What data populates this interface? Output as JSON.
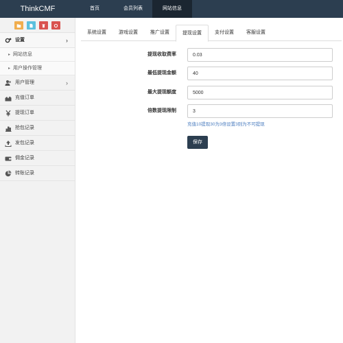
{
  "brand": "ThinkCMF",
  "topnav": {
    "items": [
      {
        "label": "首页"
      },
      {
        "label": "会员列表"
      },
      {
        "label": "网站信息"
      }
    ]
  },
  "sidebar": {
    "shortcuts": [
      {
        "icon": "folder-icon",
        "color": "#f0ad4e"
      },
      {
        "icon": "file-icon",
        "color": "#5bc0de"
      },
      {
        "icon": "trash-icon",
        "color": "#d9534f"
      },
      {
        "icon": "recycle-icon",
        "color": "#d9534f"
      }
    ],
    "menu": {
      "settings": "设置",
      "site_info": "网站信息",
      "user_action_mgmt": "用户操作管理",
      "user_mgmt": "用户管理",
      "recharge_orders": "充值订单",
      "withdraw_orders": "提现订单",
      "grab_records": "抢包记录",
      "send_records": "发包记录",
      "commission_records": "佣金记录",
      "transfer_records": "转账记录"
    }
  },
  "tabs": [
    {
      "label": "系统设置"
    },
    {
      "label": "游戏设置"
    },
    {
      "label": "推广设置"
    },
    {
      "label": "提现设置",
      "active": true
    },
    {
      "label": "支付设置"
    },
    {
      "label": "客服设置"
    }
  ],
  "form": {
    "fields": [
      {
        "label": "提现收取费率",
        "value": "0.03"
      },
      {
        "label": "最低提现金额",
        "value": "40"
      },
      {
        "label": "最大提现额度",
        "value": "5000"
      },
      {
        "label": "倍数提现限制",
        "value": "3"
      }
    ],
    "hint": "充值10提现30为3倍设置3则为不可提现",
    "save_label": "保存"
  },
  "colors": {
    "topbar": "#2c3e50",
    "topbar_active": "#1b2631",
    "hint_text": "#4a7cbf",
    "save_button": "#2c3e50"
  }
}
